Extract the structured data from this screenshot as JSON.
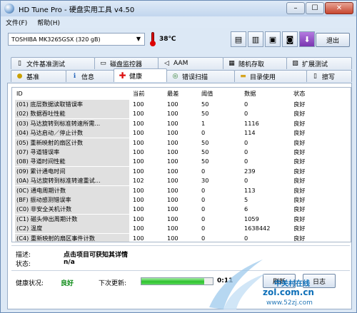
{
  "window": {
    "title": "HD Tune Pro - 硬盘实用工具 v4.50"
  },
  "menu": [
    "文件(F)",
    "帮助(H)"
  ],
  "toolbar": {
    "drive": "TOSHIBA MK3265GSX     (320 gB)",
    "temperature": "38℃",
    "exit_label": "退出"
  },
  "tabs_top": [
    "文件基准测试",
    "磁盘监控器",
    "AAM",
    "随机存取",
    "扩展测试"
  ],
  "tabs_bottom": [
    "基准",
    "信息",
    "健康",
    "错误扫描",
    "目录使用",
    "擦写"
  ],
  "table": {
    "headers": [
      "ID",
      "当前",
      "最差",
      "阈值",
      "数据",
      "状态"
    ],
    "rows": [
      [
        "(01) 底层数据读取错误率",
        "100",
        "100",
        "50",
        "0",
        "良好"
      ],
      [
        "(02) 数据吞吐性能",
        "100",
        "100",
        "50",
        "0",
        "良好"
      ],
      [
        "(03) 马达旋转到标准转速所需...",
        "100",
        "100",
        "1",
        "1116",
        "良好"
      ],
      [
        "(04) 马达启动／停止计数",
        "100",
        "100",
        "0",
        "114",
        "良好"
      ],
      [
        "(05) 重新映射的扇区计数",
        "100",
        "100",
        "50",
        "0",
        "良好"
      ],
      [
        "(07) 寻道错误率",
        "100",
        "100",
        "50",
        "0",
        "良好"
      ],
      [
        "(08) 寻道时间性能",
        "100",
        "100",
        "50",
        "0",
        "良好"
      ],
      [
        "(09) 累计通电时间",
        "100",
        "100",
        "0",
        "239",
        "良好"
      ],
      [
        "(0A) 马达旋转到标准转速重试...",
        "102",
        "100",
        "30",
        "0",
        "良好"
      ],
      [
        "(0C) 通电周期计数",
        "100",
        "100",
        "0",
        "113",
        "良好"
      ],
      [
        "(BF) 振动感测错误率",
        "100",
        "100",
        "0",
        "5",
        "良好"
      ],
      [
        "(C0) 非安全关机计数",
        "100",
        "100",
        "0",
        "6",
        "良好"
      ],
      [
        "(C1) 磁头伸出周期计数",
        "100",
        "100",
        "0",
        "1059",
        "良好"
      ],
      [
        "(C2) 温度",
        "100",
        "100",
        "0",
        "1638442",
        "良好"
      ],
      [
        "(C4) 重新映射的扇区事件计数",
        "100",
        "100",
        "0",
        "0",
        "良好"
      ]
    ]
  },
  "details": {
    "desc_label": "描述:",
    "desc_value": "点击项目可获知其详情",
    "state_label": "状态:",
    "state_value": "n/a"
  },
  "footer": {
    "health_label": "健康状况:",
    "health_value": "良好",
    "next_label": "下次更新:",
    "progress": 0.88,
    "timer": "0:11",
    "refresh_label": "刷新",
    "log_label": "日志"
  },
  "watermark": {
    "logo": "中关村在线",
    "site": "zol.com.cn",
    "url": "www.52zj.com"
  },
  "colors": {
    "health_good": "#0a8a14",
    "progress": "#2ec22e",
    "accent": "#0d6fb8"
  },
  "icons": [
    "hdd-icon",
    "thermometer-icon",
    "copy-icon",
    "save-icon",
    "camera-icon",
    "download-icon"
  ]
}
